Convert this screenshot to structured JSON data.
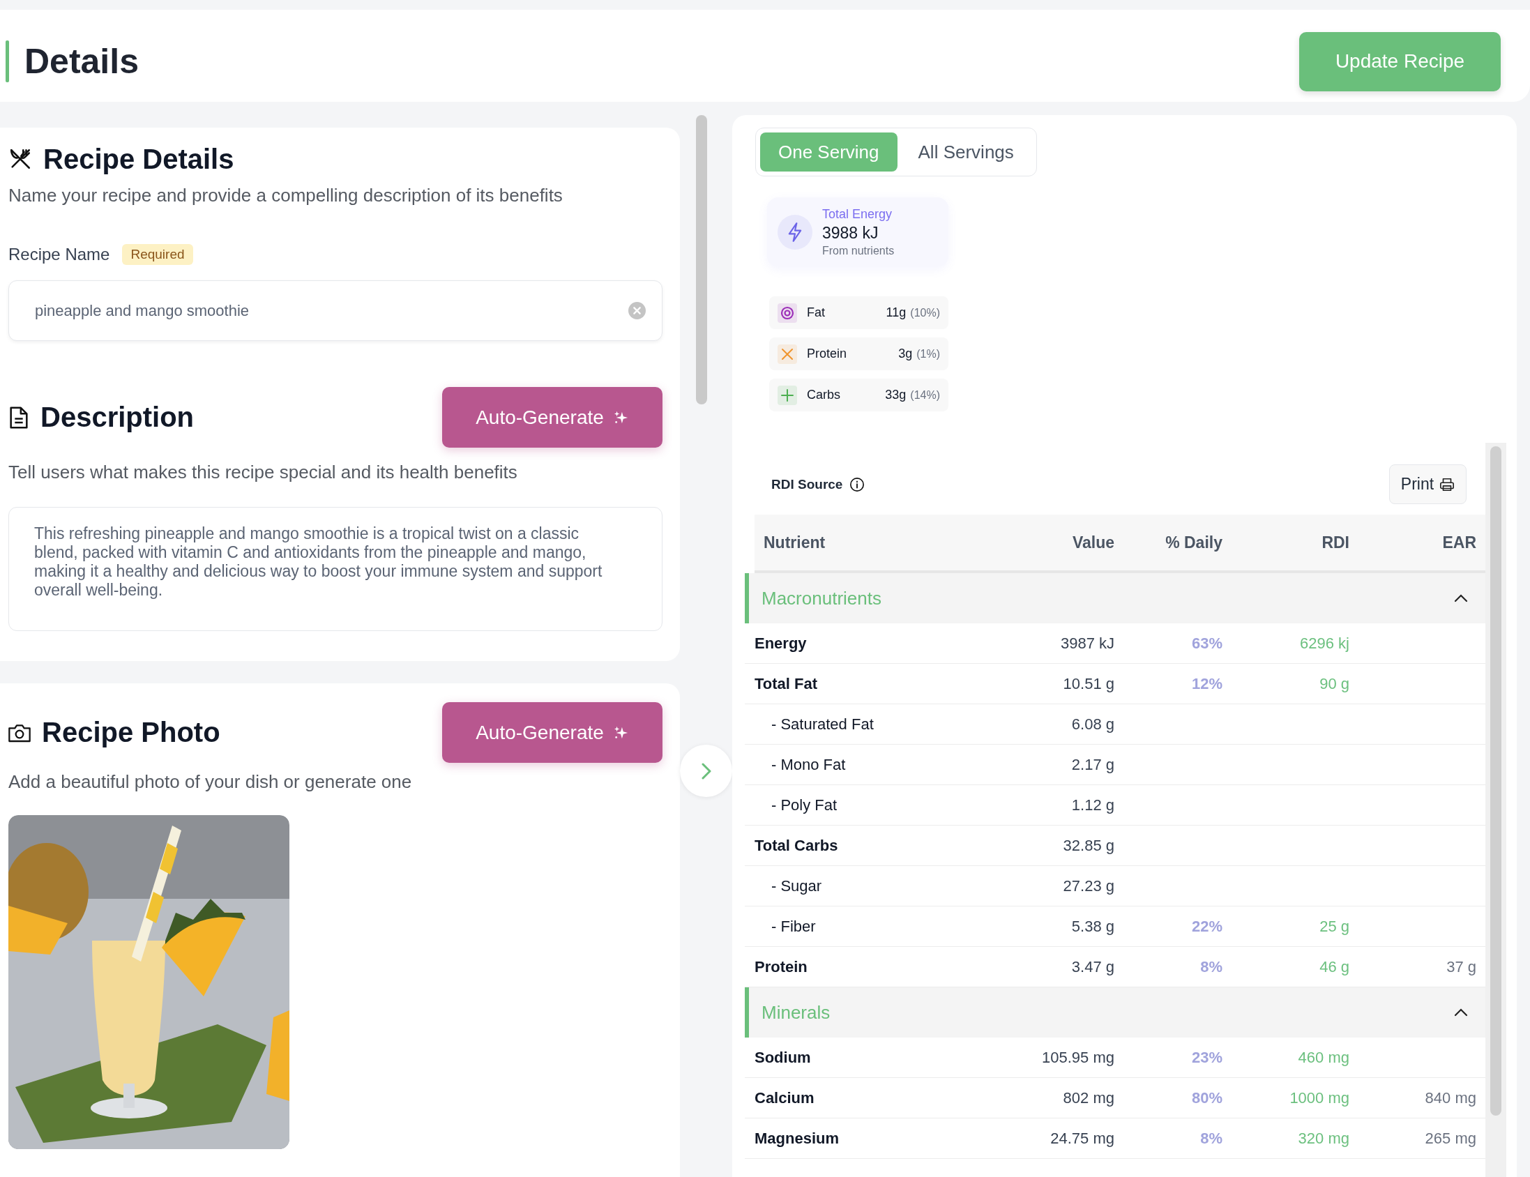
{
  "header": {
    "title": "Details",
    "update_button": "Update Recipe"
  },
  "recipe_details": {
    "title": "Recipe Details",
    "subtitle": "Name your recipe and provide a compelling description of its benefits",
    "name_label": "Recipe Name",
    "required_badge": "Required",
    "name_value": "pineapple and mango smoothie"
  },
  "description": {
    "title": "Description",
    "button": "Auto-Generate",
    "subtitle": "Tell users what makes this recipe special and its health benefits",
    "text": "This refreshing pineapple and mango smoothie is a tropical twist on a classic blend, packed with vitamin C and antioxidants from the pineapple and mango, making it a healthy and delicious way to boost your immune system and support overall well-being."
  },
  "photo": {
    "title": "Recipe Photo",
    "button": "Auto-Generate",
    "subtitle": "Add a beautiful photo of your dish or generate one"
  },
  "serving_tabs": [
    {
      "label": "One Serving",
      "selected": true
    },
    {
      "label": "All Servings",
      "selected": false
    }
  ],
  "energy": {
    "label": "Total Energy",
    "value": "3988 kJ",
    "note": "From nutrients"
  },
  "macros": [
    {
      "kind": "fat",
      "name": "Fat",
      "amount": "11g",
      "percent": "(10%)",
      "color": "#9c2fb8"
    },
    {
      "kind": "protein",
      "name": "Protein",
      "amount": "3g",
      "percent": "(1%)",
      "color": "#f0952e"
    },
    {
      "kind": "carbs",
      "name": "Carbs",
      "amount": "33g",
      "percent": "(14%)",
      "color": "#4caf50"
    }
  ],
  "rdi_source": "RDI Source",
  "print_button": "Print",
  "table": {
    "columns": [
      "Nutrient",
      "Value",
      "% Daily",
      "RDI",
      "EAR"
    ],
    "groups": [
      {
        "name": "Macronutrients",
        "expanded": true,
        "rows": [
          {
            "nutrient": "Energy",
            "value": "3987 kJ",
            "daily": "63%",
            "rdi": "6296 kj"
          },
          {
            "nutrient": "Total Fat",
            "value": "10.51 g",
            "daily": "12%",
            "rdi": "90 g",
            "children": [
              {
                "nutrient": "- Saturated Fat",
                "value": "6.08 g"
              },
              {
                "nutrient": "- Mono Fat",
                "value": "2.17 g"
              },
              {
                "nutrient": "- Poly Fat",
                "value": "1.12 g"
              }
            ]
          },
          {
            "nutrient": "Total Carbs",
            "value": "32.85 g",
            "children": [
              {
                "nutrient": "- Sugar",
                "value": "27.23 g"
              },
              {
                "nutrient": "- Fiber",
                "value": "5.38 g",
                "daily": "22%",
                "rdi": "25 g"
              }
            ]
          },
          {
            "nutrient": "Protein",
            "value": "3.47 g",
            "daily": "8%",
            "rdi": "46 g",
            "ear": "37 g"
          }
        ]
      },
      {
        "name": "Minerals",
        "expanded": true,
        "rows": [
          {
            "nutrient": "Sodium",
            "value": "105.95 mg",
            "daily": "23%",
            "rdi": "460 mg"
          },
          {
            "nutrient": "Calcium",
            "value": "802 mg",
            "daily": "80%",
            "rdi": "1000 mg",
            "ear": "840 mg"
          },
          {
            "nutrient": "Magnesium",
            "value": "24.75 mg",
            "daily": "8%",
            "rdi": "320 mg",
            "ear": "265 mg"
          }
        ]
      }
    ]
  }
}
